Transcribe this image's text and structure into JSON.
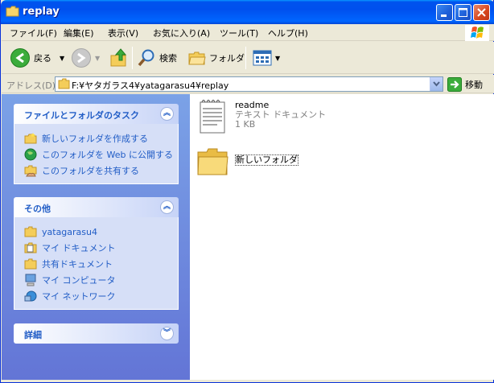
{
  "window": {
    "title": "replay"
  },
  "menu": [
    "ファイル(F)",
    "編集(E)",
    "表示(V)",
    "お気に入り(A)",
    "ツール(T)",
    "ヘルプ(H)"
  ],
  "toolbar": {
    "back": "戻る",
    "search": "検索",
    "folders": "フォルダ"
  },
  "address": {
    "label": "アドレス(D)",
    "value": "F:¥ヤタガラス4¥yatagarasu4¥replay",
    "go": "移動"
  },
  "tasks": {
    "title": "ファイルとフォルダのタスク",
    "items": [
      "新しいフォルダを作成する",
      "このフォルダを Web に公開する",
      "このフォルダを共有する"
    ]
  },
  "other": {
    "title": "その他",
    "items": [
      "yatagarasu4",
      "マイ ドキュメント",
      "共有ドキュメント",
      "マイ コンピュータ",
      "マイ ネットワーク"
    ]
  },
  "details": {
    "title": "詳細"
  },
  "files": [
    {
      "name": "readme",
      "type": "テキスト ドキュメント",
      "size": "1 KB",
      "icon": "text-document-icon"
    },
    {
      "name": "新しいフォルダ",
      "icon": "folder-icon"
    }
  ],
  "colors": {
    "titlebar": "#0054e3",
    "taskpane": "#7ba2e7",
    "link": "#215dc6"
  }
}
